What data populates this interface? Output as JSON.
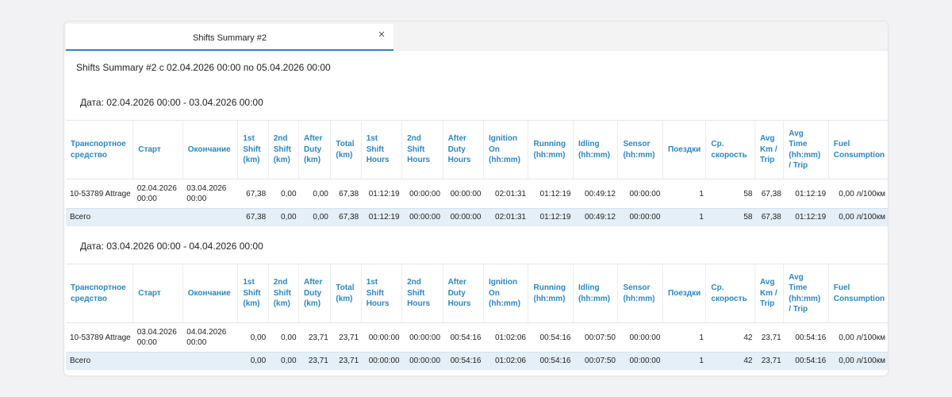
{
  "tab": {
    "title": "Shifts Summary #2",
    "close": "×"
  },
  "report_title": "Shifts Summary #2 с 02.04.2026 00:00 по 05.04.2026 00:00",
  "columns": [
    "Транспортное средство",
    "Старт",
    "Окончание",
    "1st Shift (km)",
    "2nd Shift (km)",
    "After Duty (km)",
    "Total (km)",
    "1st Shift Hours",
    "2nd Shift Hours",
    "After Duty Hours",
    "Ignition On (hh:mm)",
    "Running (hh:mm)",
    "Idling (hh:mm)",
    "Sensor (hh:mm)",
    "Поездки",
    "Ср. скорость",
    "Avg Km / Trip",
    "Avg Time (hh:mm) / Trip",
    "Fuel Consumption"
  ],
  "sections": [
    {
      "date": "Дата: 02.04.2026 00:00 - 03.04.2026 00:00",
      "row": [
        "10-53789 Attrage",
        "02.04.2026 00:00",
        "03.04.2026 00:00",
        "67,38",
        "0,00",
        "0,00",
        "67,38",
        "01:12:19",
        "00:00:00",
        "00:00:00",
        "02:01:31",
        "01:12:19",
        "00:49:12",
        "00:00:00",
        "1",
        "58",
        "67,38",
        "01:12:19",
        "0,00 л/100км"
      ],
      "total": [
        "Всего",
        "",
        "",
        "67,38",
        "0,00",
        "0,00",
        "67,38",
        "01:12:19",
        "00:00:00",
        "00:00:00",
        "02:01:31",
        "01:12:19",
        "00:49:12",
        "00:00:00",
        "1",
        "58",
        "67,38",
        "01:12:19",
        "0,00 л/100км"
      ]
    },
    {
      "date": "Дата: 03.04.2026 00:00 - 04.04.2026 00:00",
      "row": [
        "10-53789 Attrage",
        "03.04.2026 00:00",
        "04.04.2026 00:00",
        "0,00",
        "0,00",
        "23,71",
        "23,71",
        "00:00:00",
        "00:00:00",
        "00:54:16",
        "01:02:06",
        "00:54:16",
        "00:07:50",
        "00:00:00",
        "1",
        "42",
        "23,71",
        "00:54:16",
        "0,00 л/100км"
      ],
      "total": [
        "Всего",
        "",
        "",
        "0,00",
        "0,00",
        "23,71",
        "23,71",
        "00:00:00",
        "00:00:00",
        "00:54:16",
        "01:02:06",
        "00:54:16",
        "00:07:50",
        "00:00:00",
        "1",
        "42",
        "23,71",
        "00:54:16",
        "0,00 л/100км"
      ]
    }
  ]
}
